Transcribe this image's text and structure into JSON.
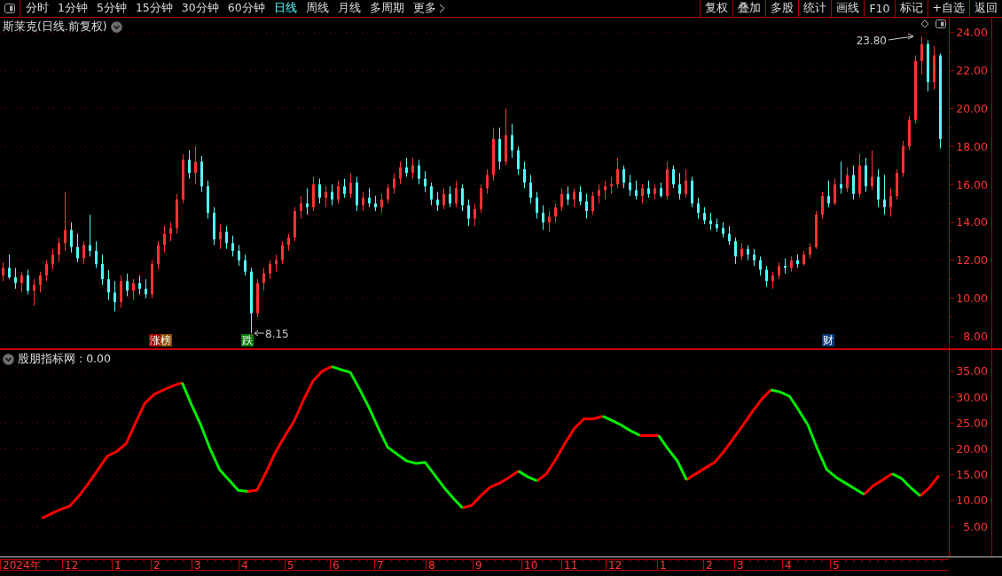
{
  "toolbar": {
    "periods": [
      {
        "label": "分时",
        "selected": false
      },
      {
        "label": "1分钟",
        "selected": false
      },
      {
        "label": "5分钟",
        "selected": false
      },
      {
        "label": "15分钟",
        "selected": false
      },
      {
        "label": "30分钟",
        "selected": false
      },
      {
        "label": "60分钟",
        "selected": false
      },
      {
        "label": "日线",
        "selected": true
      },
      {
        "label": "周线",
        "selected": false
      },
      {
        "label": "月线",
        "selected": false
      },
      {
        "label": "多周期",
        "selected": false
      },
      {
        "label": "更多",
        "selected": false
      }
    ],
    "actions": [
      "复权",
      "叠加",
      "多股",
      "统计",
      "画线",
      "F10",
      "标记",
      "+自选",
      "返回"
    ]
  },
  "price_chart": {
    "title": "斯莱克(日线.前复权)",
    "high_label": "23.80",
    "low_label": "8.15",
    "events": [
      {
        "label": "涨榜",
        "kind": "rank"
      },
      {
        "label": "跌",
        "kind": "fall"
      },
      {
        "label": "财",
        "kind": "finance"
      }
    ],
    "chart_data": {
      "type": "candlestick",
      "ylim": [
        7.36,
        24.79
      ],
      "grid": true,
      "yticks": [
        {
          "value": 24,
          "label": "24.00"
        },
        {
          "value": 22,
          "label": "22.00"
        },
        {
          "value": 20,
          "label": "20.00"
        },
        {
          "value": 18,
          "label": "18.00"
        },
        {
          "value": 16,
          "label": "16.00"
        },
        {
          "value": 14,
          "label": "14.00"
        },
        {
          "value": 12,
          "label": "12.00"
        },
        {
          "value": 10,
          "label": "10.00"
        },
        {
          "value": 8,
          "label": "8.00"
        }
      ],
      "ohlc": [
        [
          11.2,
          11.9,
          10.9,
          11.6
        ],
        [
          11.6,
          12.3,
          11.0,
          11.1
        ],
        [
          11.1,
          11.6,
          10.5,
          10.8
        ],
        [
          10.8,
          11.4,
          10.3,
          11.2
        ],
        [
          11.2,
          11.5,
          10.2,
          10.4
        ],
        [
          10.4,
          11.0,
          9.6,
          10.7
        ],
        [
          10.7,
          11.4,
          10.3,
          11.2
        ],
        [
          11.2,
          12.0,
          10.9,
          11.8
        ],
        [
          11.8,
          12.6,
          11.5,
          12.3
        ],
        [
          12.3,
          13.2,
          11.9,
          12.9
        ],
        [
          12.9,
          15.6,
          12.5,
          13.6
        ],
        [
          13.6,
          14.0,
          12.4,
          12.7
        ],
        [
          12.7,
          13.4,
          11.9,
          12.1
        ],
        [
          12.1,
          13.0,
          11.8,
          12.8
        ],
        [
          12.8,
          14.4,
          12.2,
          12.5
        ],
        [
          12.5,
          13.0,
          11.6,
          11.8
        ],
        [
          11.8,
          12.3,
          10.7,
          11.0
        ],
        [
          11.0,
          11.5,
          9.9,
          10.3
        ],
        [
          10.3,
          10.9,
          9.3,
          9.8
        ],
        [
          9.8,
          11.2,
          9.5,
          10.9
        ],
        [
          10.9,
          11.3,
          10.1,
          10.4
        ],
        [
          10.4,
          11.0,
          9.9,
          10.8
        ],
        [
          10.8,
          11.2,
          10.2,
          10.5
        ],
        [
          10.5,
          11.0,
          10.0,
          10.2
        ],
        [
          10.2,
          12.0,
          10.0,
          11.8
        ],
        [
          11.8,
          13.0,
          11.5,
          12.8
        ],
        [
          12.8,
          13.8,
          12.4,
          13.4
        ],
        [
          13.4,
          14.0,
          13.0,
          13.7
        ],
        [
          13.7,
          15.5,
          13.4,
          15.2
        ],
        [
          15.2,
          17.6,
          15.0,
          17.3
        ],
        [
          17.3,
          17.8,
          16.3,
          16.6
        ],
        [
          16.6,
          18.0,
          16.0,
          17.2
        ],
        [
          17.2,
          17.5,
          15.6,
          15.9
        ],
        [
          15.9,
          16.2,
          14.2,
          14.5
        ],
        [
          14.5,
          14.8,
          12.8,
          13.1
        ],
        [
          13.1,
          13.9,
          12.6,
          13.5
        ],
        [
          13.5,
          13.8,
          12.6,
          12.9
        ],
        [
          12.9,
          13.3,
          12.2,
          12.5
        ],
        [
          12.5,
          12.8,
          11.7,
          12.0
        ],
        [
          12.0,
          12.3,
          11.2,
          11.4
        ],
        [
          11.4,
          11.6,
          8.15,
          9.2
        ],
        [
          9.2,
          11.0,
          9.0,
          10.8
        ],
        [
          10.8,
          11.6,
          10.4,
          11.3
        ],
        [
          11.3,
          12.0,
          11.0,
          11.8
        ],
        [
          11.8,
          12.3,
          11.4,
          12.0
        ],
        [
          12.0,
          13.0,
          11.8,
          12.8
        ],
        [
          12.8,
          13.4,
          12.5,
          13.2
        ],
        [
          13.2,
          14.8,
          13.0,
          14.6
        ],
        [
          14.6,
          15.4,
          14.2,
          15.0
        ],
        [
          15.0,
          15.8,
          14.4,
          14.8
        ],
        [
          14.8,
          16.4,
          14.6,
          16.0
        ],
        [
          16.0,
          16.3,
          15.0,
          15.3
        ],
        [
          15.3,
          15.9,
          14.8,
          15.6
        ],
        [
          15.6,
          16.0,
          14.9,
          15.2
        ],
        [
          15.2,
          16.2,
          15.0,
          15.9
        ],
        [
          15.9,
          16.3,
          15.3,
          15.5
        ],
        [
          15.5,
          16.6,
          15.3,
          16.1
        ],
        [
          16.1,
          16.4,
          14.6,
          14.9
        ],
        [
          14.9,
          15.6,
          14.6,
          15.3
        ],
        [
          15.3,
          15.8,
          14.8,
          15.0
        ],
        [
          15.0,
          15.4,
          14.6,
          14.8
        ],
        [
          14.8,
          15.5,
          14.5,
          15.2
        ],
        [
          15.2,
          16.0,
          15.0,
          15.8
        ],
        [
          15.8,
          16.6,
          15.5,
          16.3
        ],
        [
          16.3,
          17.2,
          16.0,
          16.9
        ],
        [
          16.9,
          17.4,
          16.4,
          16.6
        ],
        [
          16.6,
          17.4,
          16.3,
          17.0
        ],
        [
          17.0,
          17.3,
          16.0,
          16.3
        ],
        [
          16.3,
          16.7,
          15.6,
          15.9
        ],
        [
          15.9,
          16.1,
          14.9,
          15.2
        ],
        [
          15.2,
          15.6,
          14.6,
          14.9
        ],
        [
          14.9,
          15.8,
          14.7,
          15.5
        ],
        [
          15.5,
          15.9,
          14.8,
          15.0
        ],
        [
          15.0,
          16.2,
          14.8,
          15.8
        ],
        [
          15.8,
          16.0,
          14.6,
          14.9
        ],
        [
          14.9,
          15.2,
          13.8,
          14.2
        ],
        [
          14.2,
          15.0,
          13.8,
          14.7
        ],
        [
          14.7,
          16.0,
          14.5,
          15.8
        ],
        [
          15.8,
          16.8,
          15.5,
          16.5
        ],
        [
          16.5,
          19.0,
          16.2,
          18.4
        ],
        [
          18.4,
          19.0,
          16.8,
          17.2
        ],
        [
          17.2,
          20.0,
          17.0,
          18.6
        ],
        [
          18.6,
          19.2,
          17.4,
          17.8
        ],
        [
          17.8,
          18.0,
          16.5,
          16.8
        ],
        [
          16.8,
          17.2,
          15.8,
          16.1
        ],
        [
          16.1,
          16.5,
          15.0,
          15.3
        ],
        [
          15.3,
          15.6,
          14.2,
          14.5
        ],
        [
          14.5,
          14.9,
          13.6,
          14.0
        ],
        [
          14.0,
          14.6,
          13.5,
          14.3
        ],
        [
          14.3,
          15.0,
          14.0,
          14.8
        ],
        [
          14.8,
          15.8,
          14.6,
          15.5
        ],
        [
          15.5,
          15.9,
          14.9,
          15.2
        ],
        [
          15.2,
          15.8,
          14.8,
          15.6
        ],
        [
          15.6,
          15.9,
          14.9,
          15.1
        ],
        [
          15.1,
          15.5,
          14.2,
          14.6
        ],
        [
          14.6,
          15.6,
          14.4,
          15.4
        ],
        [
          15.4,
          16.0,
          15.0,
          15.7
        ],
        [
          15.7,
          16.2,
          15.2,
          15.9
        ],
        [
          15.9,
          16.4,
          15.5,
          16.0
        ],
        [
          16.0,
          17.4,
          15.8,
          16.8
        ],
        [
          16.8,
          17.0,
          15.8,
          16.1
        ],
        [
          16.1,
          16.5,
          15.4,
          15.7
        ],
        [
          15.7,
          16.2,
          15.2,
          15.4
        ],
        [
          15.4,
          16.0,
          15.0,
          15.8
        ],
        [
          15.8,
          16.2,
          15.3,
          15.5
        ],
        [
          15.5,
          16.0,
          15.2,
          15.8
        ],
        [
          15.8,
          16.1,
          15.3,
          15.4
        ],
        [
          15.4,
          17.2,
          15.2,
          16.8
        ],
        [
          16.8,
          17.0,
          15.8,
          16.0
        ],
        [
          16.0,
          16.6,
          15.2,
          15.5
        ],
        [
          15.5,
          16.8,
          15.3,
          16.2
        ],
        [
          16.2,
          16.4,
          14.8,
          15.0
        ],
        [
          15.0,
          15.3,
          14.2,
          14.5
        ],
        [
          14.5,
          14.8,
          13.9,
          14.1
        ],
        [
          14.1,
          14.5,
          13.6,
          13.9
        ],
        [
          13.9,
          14.2,
          13.5,
          13.7
        ],
        [
          13.7,
          14.0,
          13.2,
          13.4
        ],
        [
          13.4,
          13.8,
          12.8,
          13.0
        ],
        [
          13.0,
          13.2,
          11.8,
          12.2
        ],
        [
          12.2,
          12.9,
          12.0,
          12.6
        ],
        [
          12.6,
          12.8,
          12.0,
          12.3
        ],
        [
          12.3,
          12.6,
          11.7,
          12.0
        ],
        [
          12.0,
          12.2,
          11.2,
          11.5
        ],
        [
          11.5,
          11.7,
          10.6,
          10.9
        ],
        [
          10.9,
          11.4,
          10.5,
          11.2
        ],
        [
          11.2,
          11.9,
          11.0,
          11.7
        ],
        [
          11.7,
          12.1,
          11.3,
          11.6
        ],
        [
          11.6,
          12.2,
          11.4,
          12.0
        ],
        [
          12.0,
          12.3,
          11.6,
          11.8
        ],
        [
          11.8,
          12.5,
          11.7,
          12.3
        ],
        [
          12.3,
          12.9,
          12.1,
          12.7
        ],
        [
          12.7,
          14.6,
          12.6,
          14.4
        ],
        [
          14.4,
          15.6,
          14.2,
          15.4
        ],
        [
          15.4,
          16.2,
          14.8,
          15.0
        ],
        [
          15.0,
          16.3,
          14.9,
          16.0
        ],
        [
          16.0,
          17.2,
          15.5,
          15.8
        ],
        [
          15.8,
          16.9,
          15.6,
          16.5
        ],
        [
          16.5,
          17.0,
          15.2,
          15.5
        ],
        [
          15.5,
          17.6,
          15.3,
          17.0
        ],
        [
          17.0,
          17.4,
          15.6,
          15.9
        ],
        [
          15.9,
          17.8,
          15.7,
          16.4
        ],
        [
          16.4,
          16.8,
          14.8,
          15.2
        ],
        [
          15.2,
          16.5,
          14.4,
          14.8
        ],
        [
          14.8,
          15.8,
          14.3,
          15.4
        ],
        [
          15.4,
          16.8,
          15.2,
          16.6
        ],
        [
          16.6,
          18.3,
          16.4,
          18.0
        ],
        [
          18.0,
          19.6,
          17.8,
          19.4
        ],
        [
          19.4,
          22.8,
          19.2,
          22.5
        ],
        [
          22.5,
          23.8,
          21.8,
          23.4
        ],
        [
          23.4,
          23.6,
          20.9,
          21.4
        ],
        [
          21.4,
          23.3,
          21.0,
          22.8
        ],
        [
          22.8,
          22.9,
          17.9,
          18.4
        ]
      ]
    }
  },
  "indicator": {
    "title": "股朋指标网 : 0.00",
    "chart_data": {
      "type": "line",
      "ylim": [
        -0.8,
        39.1
      ],
      "grid": true,
      "yticks": [
        {
          "value": 5,
          "label": "5.00"
        },
        {
          "value": 10,
          "label": "10.00"
        },
        {
          "value": 15,
          "label": "15.00"
        },
        {
          "value": 20,
          "label": "20.00"
        },
        {
          "value": 25,
          "label": "25.00"
        },
        {
          "value": 30,
          "label": "30.00"
        },
        {
          "value": 35,
          "label": "35.00"
        }
      ],
      "series": [
        {
          "color": "#ff0000",
          "values": [
            null,
            null,
            null,
            null,
            6.6,
            7.5,
            8.3,
            9.0,
            11.0,
            13.4,
            16.0,
            18.6,
            19.5,
            21.0,
            25.0,
            28.8,
            30.5,
            31.4,
            32.2,
            32.8,
            null,
            null,
            null,
            null,
            null,
            null,
            11.8,
            12.0,
            15.5,
            19.4,
            22.5,
            25.4,
            29.5,
            33.1,
            35.0,
            35.9,
            null,
            null,
            null,
            null,
            null,
            null,
            null,
            null,
            null,
            null,
            null,
            null,
            null,
            8.6,
            9.1,
            11.0,
            12.6,
            13.4,
            14.5,
            15.7,
            null,
            13.8,
            15.2,
            18.0,
            21.1,
            24.0,
            25.8,
            25.8,
            26.3,
            null,
            null,
            null,
            22.6,
            22.6,
            22.6,
            null,
            null,
            14.0,
            15.2,
            16.3,
            17.4,
            19.5,
            22.0,
            24.5,
            27.1,
            29.5,
            31.4,
            null,
            null,
            null,
            null,
            null,
            null,
            null,
            null,
            null,
            11.2,
            12.9,
            14.0,
            15.2,
            null,
            null,
            10.9,
            12.5,
            14.8
          ]
        },
        {
          "color": "#00ee00",
          "values": [
            null,
            null,
            null,
            null,
            null,
            null,
            null,
            null,
            null,
            null,
            null,
            null,
            null,
            null,
            null,
            null,
            null,
            null,
            null,
            32.8,
            28.5,
            24.6,
            20.0,
            16.0,
            14.0,
            12.0,
            11.8,
            null,
            null,
            null,
            null,
            null,
            null,
            null,
            null,
            35.9,
            35.3,
            34.8,
            31.5,
            28.0,
            24.0,
            20.3,
            19.0,
            17.7,
            17.2,
            17.4,
            15.0,
            12.6,
            10.5,
            8.6,
            null,
            null,
            null,
            null,
            null,
            15.7,
            14.6,
            13.8,
            null,
            null,
            null,
            null,
            null,
            null,
            26.3,
            25.5,
            24.6,
            23.5,
            22.6,
            null,
            22.6,
            20.0,
            17.7,
            14.0,
            null,
            null,
            null,
            null,
            null,
            null,
            null,
            null,
            31.4,
            31.0,
            30.2,
            27.5,
            24.6,
            20.0,
            16.0,
            14.5,
            13.4,
            12.3,
            11.2,
            null,
            null,
            15.2,
            14.3,
            12.5,
            10.9,
            null,
            null
          ]
        }
      ]
    }
  },
  "date_axis": {
    "labels": [
      "2024年",
      "12",
      "1",
      "2",
      "3",
      "4",
      "5",
      "6",
      "7",
      "8",
      "9",
      "10",
      "11",
      "12",
      "1",
      "2",
      "3",
      "4",
      "5"
    ]
  }
}
